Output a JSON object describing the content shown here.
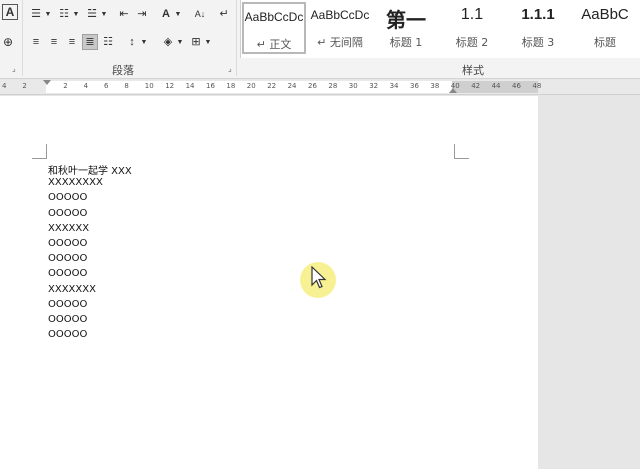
{
  "ribbon": {
    "paragraph_group_label": "段落",
    "styles_group_label": "样式",
    "styles": [
      {
        "preview": "AaBbCcDc",
        "name": "↵ 正文",
        "active": true
      },
      {
        "preview": "AaBbCcDc",
        "name": "↵ 无间隔",
        "active": false
      },
      {
        "preview": "第一",
        "name": "标题 1",
        "active": false
      },
      {
        "preview": "1.1",
        "name": "标题 2",
        "active": false
      },
      {
        "preview": "1.1.1",
        "name": "标题 3",
        "active": false
      },
      {
        "preview": "AaBbC",
        "name": "标题",
        "active": false
      }
    ]
  },
  "ruler": {
    "ticks": [
      "4",
      "2",
      "",
      "2",
      "4",
      "6",
      "8",
      "10",
      "12",
      "14",
      "16",
      "18",
      "20",
      "22",
      "24",
      "26",
      "28",
      "30",
      "32",
      "34",
      "36",
      "38",
      "40",
      "42",
      "44",
      "46",
      "48"
    ]
  },
  "document": {
    "lines": [
      "和秋叶一起学 XXX",
      "XXXXXXXX",
      "OOOOO",
      "OOOOO",
      "XXXXXX",
      "OOOOO",
      "OOOOO",
      "OOOOO",
      "XXXXXXX",
      "OOOOO",
      "OOOOO",
      "OOOOO"
    ]
  },
  "icons": {
    "font_box": "A",
    "bullets": "bullets-icon",
    "numbering": "numbering-icon",
    "multilevel": "multilevel-list-icon",
    "decrease_indent": "decrease-indent-icon",
    "increase_indent": "increase-indent-icon",
    "chinese_layout": "chinese-layout-icon",
    "sort": "sort-icon",
    "show_marks": "paragraph-mark-icon"
  }
}
